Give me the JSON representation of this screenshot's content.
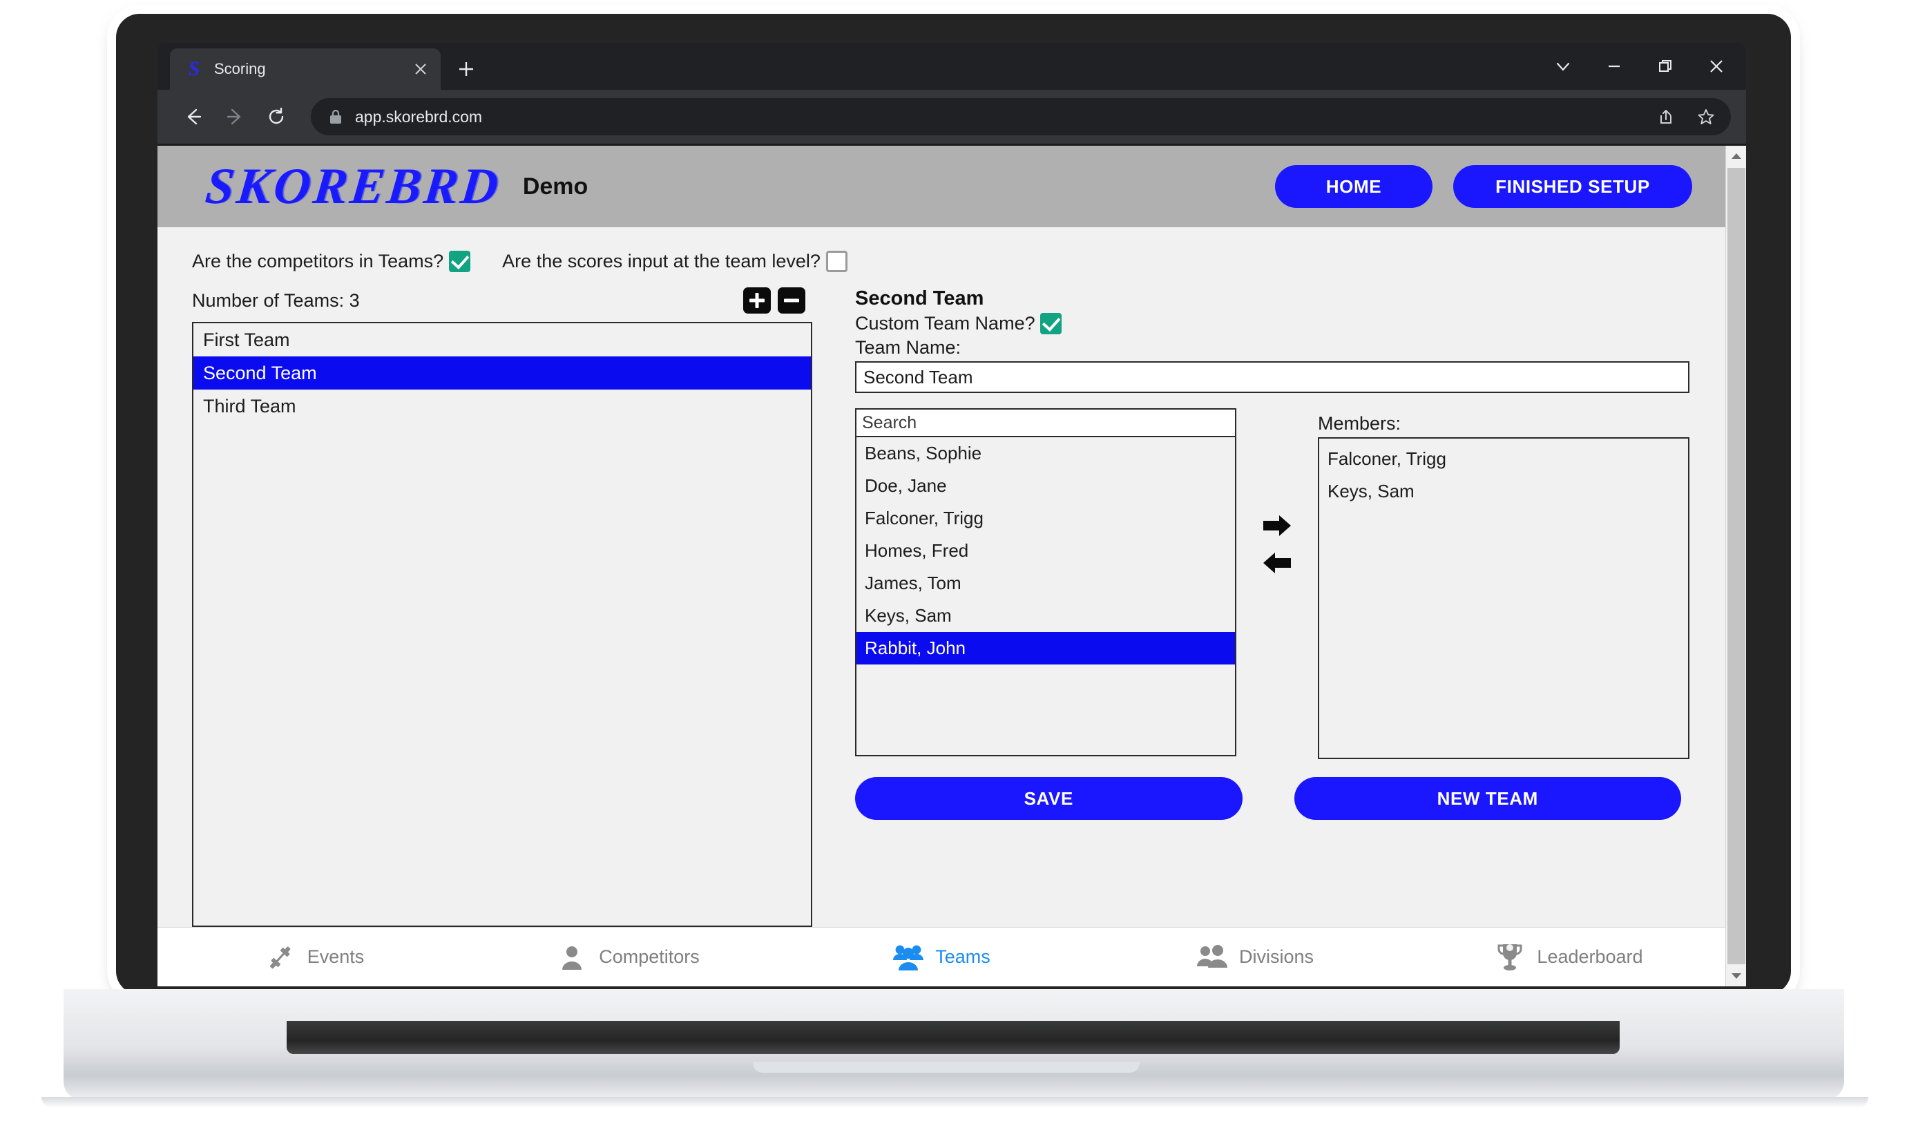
{
  "browser": {
    "tab": {
      "title": "Scoring",
      "favicon": "S",
      "close_icon": "close-icon"
    },
    "new_tab_label": "+",
    "window_controls": {
      "chevron": "chevron-down-icon",
      "minimize": "minimize-icon",
      "restore": "restore-icon",
      "close": "close-icon"
    },
    "toolbar": {
      "back": "back-arrow-icon",
      "forward": "forward-arrow-icon",
      "reload": "reload-icon",
      "lock": "lock-icon",
      "url": "app.skorebrd.com",
      "share": "share-icon",
      "bookmark": "star-icon"
    }
  },
  "app": {
    "logo_text": "SKOREBRD",
    "subtitle": "Demo",
    "home_label": "HOME",
    "finished_setup_label": "FINISHED SETUP",
    "header_bg": "#b0b0b0",
    "accent_blue": "#1a17ff",
    "checkbox_green": "#12a383",
    "select_blue": "#0b0bf0"
  },
  "options": {
    "teams_question": "Are the competitors in Teams?",
    "teams_checked": true,
    "scores_question": "Are the scores input at the team level?",
    "scores_checked": false
  },
  "teams_panel": {
    "count_label": "Number of Teams: 3",
    "add_button": "add-team-button",
    "remove_button": "remove-team-button",
    "teams": [
      {
        "name": "First Team",
        "selected": false
      },
      {
        "name": "Second Team",
        "selected": true
      },
      {
        "name": "Third Team",
        "selected": false
      }
    ]
  },
  "team_detail": {
    "title": "Second Team",
    "custom_name_label": "Custom Team Name?",
    "custom_name_checked": true,
    "team_name_label": "Team Name:",
    "team_name_value": "Second Team",
    "search_placeholder": "Search",
    "search_value": "",
    "competitors": [
      {
        "name": "Beans, Sophie",
        "selected": false
      },
      {
        "name": "Doe, Jane",
        "selected": false
      },
      {
        "name": "Falconer, Trigg",
        "selected": false
      },
      {
        "name": "Homes, Fred",
        "selected": false
      },
      {
        "name": "James, Tom",
        "selected": false
      },
      {
        "name": "Keys, Sam",
        "selected": false
      },
      {
        "name": "Rabbit, John",
        "selected": true
      }
    ],
    "add_member_arrow": "arrow-right-icon",
    "remove_member_arrow": "arrow-left-icon",
    "members_label": "Members:",
    "members": [
      {
        "name": "Falconer, Trigg"
      },
      {
        "name": "Keys, Sam"
      }
    ],
    "save_label": "SAVE",
    "new_team_label": "NEW TEAM"
  },
  "bottom_nav": {
    "items": [
      {
        "label": "Events",
        "icon": "dumbbell-icon",
        "active": false
      },
      {
        "label": "Competitors",
        "icon": "person-icon",
        "active": false
      },
      {
        "label": "Teams",
        "icon": "people-group-icon",
        "active": true
      },
      {
        "label": "Divisions",
        "icon": "two-people-icon",
        "active": false
      },
      {
        "label": "Leaderboard",
        "icon": "trophy-icon",
        "active": false
      }
    ]
  }
}
